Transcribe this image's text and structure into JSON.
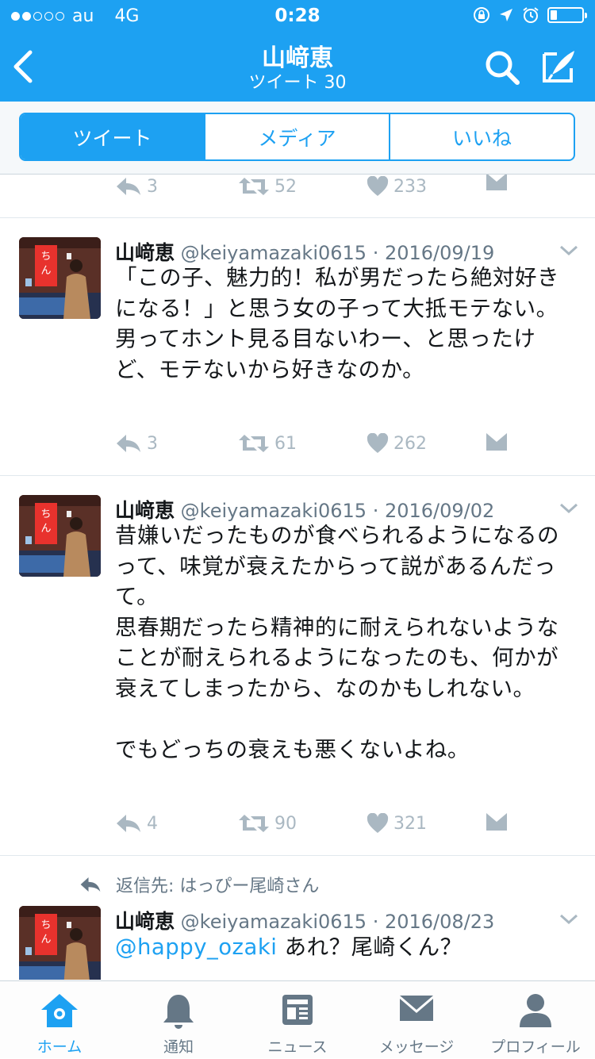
{
  "status_bar": {
    "carrier": "au",
    "network": "4G",
    "time": "0:28",
    "signal_dots_filled": 2,
    "signal_dots_total": 5,
    "battery_level": 0.2
  },
  "nav": {
    "title": "山﨑恵",
    "subtitle": "ツイート 30",
    "icons": [
      "back-icon",
      "search-icon",
      "compose-icon"
    ]
  },
  "segments": [
    {
      "label": "ツイート",
      "active": true
    },
    {
      "label": "メディア",
      "active": false
    },
    {
      "label": "いいね",
      "active": false
    }
  ],
  "top_actions": {
    "replies": "3",
    "retweets": "52",
    "likes": "233"
  },
  "tweets": [
    {
      "name": "山﨑恵",
      "meta": "@keiyamazaki0615 · 2016/09/19",
      "text": "「この子、魅力的！私が男だったら絶対好きになる！」と思う女の子って大抵モテない。\n男ってホント見る目ないわー、と思ったけど、モテないから好きなのか。",
      "replies": "3",
      "retweets": "61",
      "likes": "262"
    },
    {
      "name": "山﨑恵",
      "meta": "@keiyamazaki0615 · 2016/09/02",
      "text": "昔嫌いだったものが食べられるようになるのって、味覚が衰えたからって説があるんだって。\n思春期だったら精神的に耐えられないようなことが耐えられるようになったのも、何かが衰えてしまったから、なのかもしれない。\n\nでもどっちの衰えも悪くないよね。",
      "replies": "4",
      "retweets": "90",
      "likes": "321"
    },
    {
      "reply_to": "返信先: はっぴー尾崎さん",
      "name": "山﨑恵",
      "meta": "@keiyamazaki0615 · 2016/08/23",
      "mention": "@happy_ozaki",
      "text": " あれ？尾崎くん？"
    }
  ],
  "tabbar": [
    {
      "label": "ホーム",
      "icon": "home-icon",
      "active": true
    },
    {
      "label": "通知",
      "icon": "bell-icon",
      "active": false
    },
    {
      "label": "ニュース",
      "icon": "news-icon",
      "active": false
    },
    {
      "label": "メッセージ",
      "icon": "envelope-icon",
      "active": false
    },
    {
      "label": "プロフィール",
      "icon": "person-icon",
      "active": false
    }
  ],
  "colors": {
    "brand": "#1da1f2",
    "muted": "#aab8c2",
    "text": "#14171a",
    "meta": "#657786"
  }
}
